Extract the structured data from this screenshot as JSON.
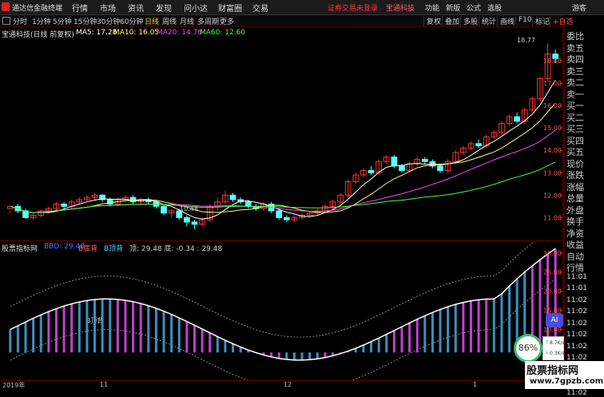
{
  "menubar": {
    "app_name": "通达信金融终端",
    "items": [
      "行情",
      "市场",
      "资讯",
      "发现",
      "问小达",
      "财富圈",
      "交易"
    ],
    "notice": "证券交易未登录",
    "stock_notice": "宝通科技",
    "right_items": [
      "功能",
      "新版",
      "公式",
      "选股",
      "游客"
    ]
  },
  "toolbar": {
    "periods": [
      "分时",
      "1分钟",
      "5分钟",
      "15分钟",
      "30分钟",
      "60分钟",
      "日线",
      "周线",
      "月线",
      "多周期",
      "更多"
    ],
    "active_period": "日线",
    "buttons": [
      "复权",
      "叠加",
      "多股",
      "统计",
      "画线",
      "F10",
      "标记",
      "+自选"
    ]
  },
  "main_chart": {
    "stock_title": "宝通科技(日线 前复权)",
    "ma5_label": "MA5: 17.28",
    "ma10_label": "MA10: 16.05",
    "ma20_label": "MA20: 14.76",
    "ma60_label": "MA60: 12.60",
    "high_label": "18.77",
    "low_label": "10.48",
    "y_ticks": [
      "18.00",
      "17.00",
      "16.00",
      "15.00",
      "14.00",
      "13.00",
      "12.00",
      "11.00"
    ]
  },
  "indicator": {
    "title": "股票指标网",
    "legend_b": "B底背",
    "legend_bb": "B顶背",
    "legend_vals": "顶: 29.48 底: -0.34 : 29.48",
    "top_left": "BBD: 29.48",
    "annotation": "B顶背",
    "y_ticks": [
      "30.00",
      "25.00",
      "20.00",
      "15.00",
      "10.00",
      "5.00"
    ]
  },
  "xaxis": {
    "labels": [
      "2019年",
      "11",
      "12",
      "1"
    ]
  },
  "sidebar": {
    "items": [
      "委比",
      "卖五",
      "卖四",
      "卖三",
      "卖二",
      "卖一",
      "买一",
      "买二",
      "买三",
      "买四",
      "买五",
      "现价",
      "涨跌",
      "涨幅",
      "总量",
      "外盘",
      "换手",
      "净资",
      "收益",
      "自动",
      "行情",
      "11:01",
      "11:01",
      "11:02",
      "11:02",
      "11:02",
      "11:02",
      "11:02",
      "11:02",
      "11:02",
      "11:02",
      "11:02"
    ]
  },
  "widgets": {
    "ai_label": "AI",
    "percent": "86%",
    "speed_up": "8.7K/s",
    "speed_down": "0.3K/s"
  },
  "watermark": {
    "line1": "股票指标网",
    "line2": "www.7gpzb.com"
  },
  "chart_data": {
    "type": "line",
    "candles": [
      [
        11.4,
        11.5,
        11.3,
        11.2
      ],
      [
        11.5,
        11.3,
        11.6,
        11.2
      ],
      [
        11.3,
        11.0,
        11.4,
        10.95
      ],
      [
        11.0,
        11.1,
        11.2,
        10.9
      ],
      [
        11.1,
        11.3,
        11.35,
        11.0
      ],
      [
        11.3,
        11.4,
        11.5,
        11.2
      ],
      [
        11.4,
        11.6,
        11.7,
        11.3
      ],
      [
        11.6,
        11.5,
        11.7,
        11.4
      ],
      [
        11.5,
        11.7,
        11.8,
        11.4
      ],
      [
        11.7,
        11.8,
        11.9,
        11.6
      ],
      [
        11.8,
        11.9,
        12.0,
        11.7
      ],
      [
        11.9,
        12.0,
        12.1,
        11.8
      ],
      [
        12.0,
        11.8,
        12.05,
        11.7
      ],
      [
        11.8,
        11.6,
        11.9,
        11.5
      ],
      [
        11.6,
        11.8,
        11.9,
        11.5
      ],
      [
        11.8,
        11.9,
        12.0,
        11.7
      ],
      [
        11.9,
        11.7,
        12.0,
        11.6
      ],
      [
        11.7,
        11.8,
        11.9,
        11.6
      ],
      [
        11.8,
        11.7,
        11.9,
        11.6
      ],
      [
        11.7,
        11.5,
        11.8,
        11.4
      ],
      [
        11.5,
        11.2,
        11.6,
        11.1
      ],
      [
        11.2,
        11.3,
        11.4,
        11.0
      ],
      [
        11.3,
        11.0,
        11.4,
        10.9
      ],
      [
        11.0,
        10.8,
        11.1,
        10.6
      ],
      [
        10.8,
        10.7,
        10.9,
        10.48
      ],
      [
        10.7,
        10.9,
        11.0,
        10.6
      ],
      [
        10.9,
        11.5,
        11.6,
        10.8
      ],
      [
        11.5,
        11.7,
        11.9,
        11.3
      ],
      [
        11.7,
        12.0,
        12.2,
        11.6
      ],
      [
        12.0,
        11.8,
        12.1,
        11.7
      ],
      [
        11.8,
        11.7,
        11.9,
        11.6
      ],
      [
        11.7,
        11.5,
        11.8,
        11.4
      ],
      [
        11.5,
        11.4,
        11.6,
        11.3
      ],
      [
        11.4,
        11.6,
        11.7,
        11.3
      ],
      [
        11.6,
        11.3,
        11.7,
        11.2
      ],
      [
        11.3,
        11.0,
        11.4,
        10.9
      ],
      [
        11.0,
        10.9,
        11.1,
        10.8
      ],
      [
        10.9,
        11.0,
        11.1,
        10.8
      ],
      [
        11.0,
        11.1,
        11.2,
        10.9
      ],
      [
        11.1,
        11.2,
        11.3,
        11.0
      ],
      [
        11.2,
        11.3,
        11.4,
        11.1
      ],
      [
        11.3,
        11.5,
        11.6,
        11.2
      ],
      [
        11.5,
        11.7,
        11.8,
        11.4
      ],
      [
        11.7,
        12.0,
        12.1,
        11.6
      ],
      [
        12.0,
        12.6,
        12.7,
        11.9
      ],
      [
        12.6,
        12.9,
        13.0,
        12.5
      ],
      [
        12.9,
        13.1,
        13.2,
        12.8
      ],
      [
        13.1,
        13.0,
        13.3,
        12.9
      ],
      [
        13.0,
        13.5,
        13.6,
        12.9
      ],
      [
        13.5,
        13.7,
        13.8,
        13.4
      ],
      [
        13.7,
        13.3,
        13.8,
        13.2
      ],
      [
        13.3,
        13.1,
        13.4,
        13.0
      ],
      [
        13.1,
        13.4,
        13.5,
        13.0
      ],
      [
        13.4,
        13.6,
        13.7,
        13.3
      ],
      [
        13.6,
        13.5,
        13.7,
        13.4
      ],
      [
        13.5,
        13.3,
        13.6,
        13.2
      ],
      [
        13.3,
        13.1,
        13.4,
        13.0
      ],
      [
        13.1,
        13.5,
        13.6,
        13.0
      ],
      [
        13.5,
        13.9,
        14.0,
        13.4
      ],
      [
        13.9,
        14.1,
        14.2,
        13.8
      ],
      [
        14.1,
        14.3,
        14.4,
        14.0
      ],
      [
        14.3,
        14.2,
        14.5,
        14.1
      ],
      [
        14.2,
        14.6,
        14.7,
        14.1
      ],
      [
        14.6,
        14.8,
        14.9,
        14.5
      ],
      [
        14.8,
        15.2,
        15.3,
        14.7
      ],
      [
        15.2,
        15.5,
        15.6,
        15.1
      ],
      [
        15.5,
        15.3,
        15.7,
        15.2
      ],
      [
        15.3,
        15.8,
        15.9,
        15.2
      ],
      [
        15.8,
        16.3,
        16.4,
        15.7
      ],
      [
        16.3,
        17.2,
        17.3,
        16.2
      ],
      [
        17.2,
        18.3,
        18.77,
        17.1
      ],
      [
        18.3,
        18.1,
        18.5,
        17.9
      ]
    ],
    "y_range": [
      10.3,
      19.0
    ],
    "indicator_range": [
      -2,
      31
    ]
  }
}
